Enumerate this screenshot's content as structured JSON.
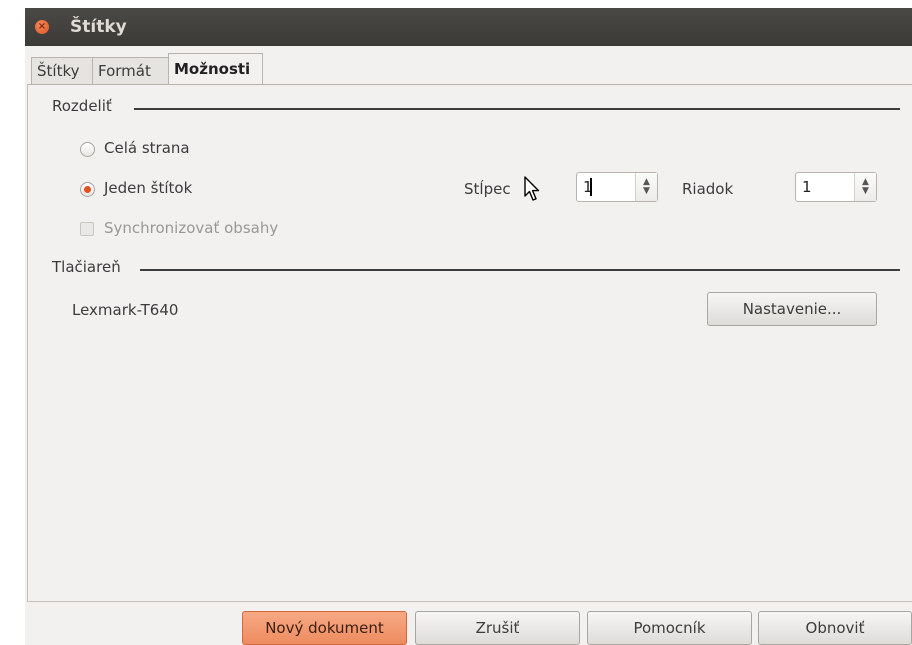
{
  "window": {
    "title": "Štítky"
  },
  "tabs": [
    {
      "label": "Štítky",
      "active": false
    },
    {
      "label": "Formát",
      "active": false
    },
    {
      "label": "Možnosti",
      "active": true
    }
  ],
  "split_section": {
    "title": "Rozdeliť",
    "option_whole_page": "Celá strana",
    "option_single_label": "Jeden štítok",
    "selected": "Jeden štítok",
    "sync_label": "Synchronizovať obsahy",
    "sync_checked": false,
    "column_label": "Stĺpec",
    "column_value": "1",
    "row_label": "Riadok",
    "row_value": "1"
  },
  "printer_section": {
    "title": "Tlačiareň",
    "printer_name": "Lexmark-T640",
    "settings_button": "Nastavenie..."
  },
  "buttons": {
    "new_document": "Nový dokument",
    "cancel": "Zrušiť",
    "help": "Pomocník",
    "reset": "Obnoviť"
  },
  "colors": {
    "accent": "#e0531f",
    "titlebar": "#3b3a37",
    "window_bg": "#f2f1f0"
  }
}
